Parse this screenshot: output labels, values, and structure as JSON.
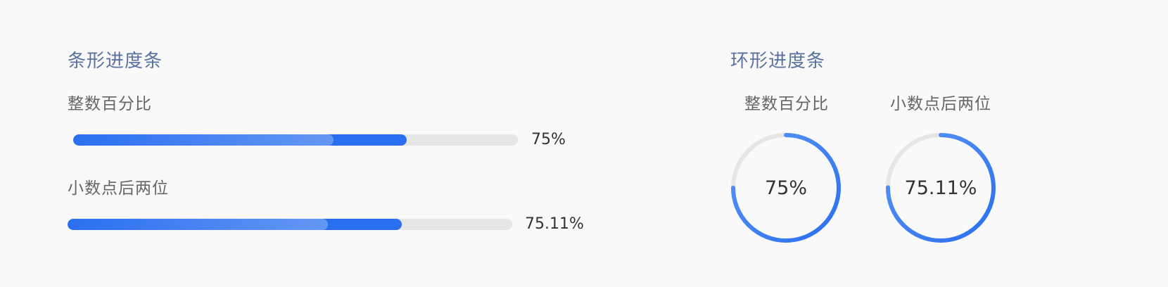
{
  "bar_section": {
    "title": "条形进度条",
    "items": [
      {
        "label": "整数百分比",
        "value_text": "75%",
        "progress": 0.75
      },
      {
        "label": "小数点后两位",
        "value_text": "75.11%",
        "progress": 0.7511
      }
    ]
  },
  "ring_section": {
    "title": "环形进度条",
    "items": [
      {
        "label": "整数百分比",
        "value_text": "75%",
        "progress": 0.75
      },
      {
        "label": "小数点后两位",
        "value_text": "75.11%",
        "progress": 0.7511
      }
    ]
  },
  "colors": {
    "accent": "#2a6ff0",
    "accent_light": "#5b95f5",
    "track": "#e6e6e6",
    "title": "#5a72a0"
  }
}
